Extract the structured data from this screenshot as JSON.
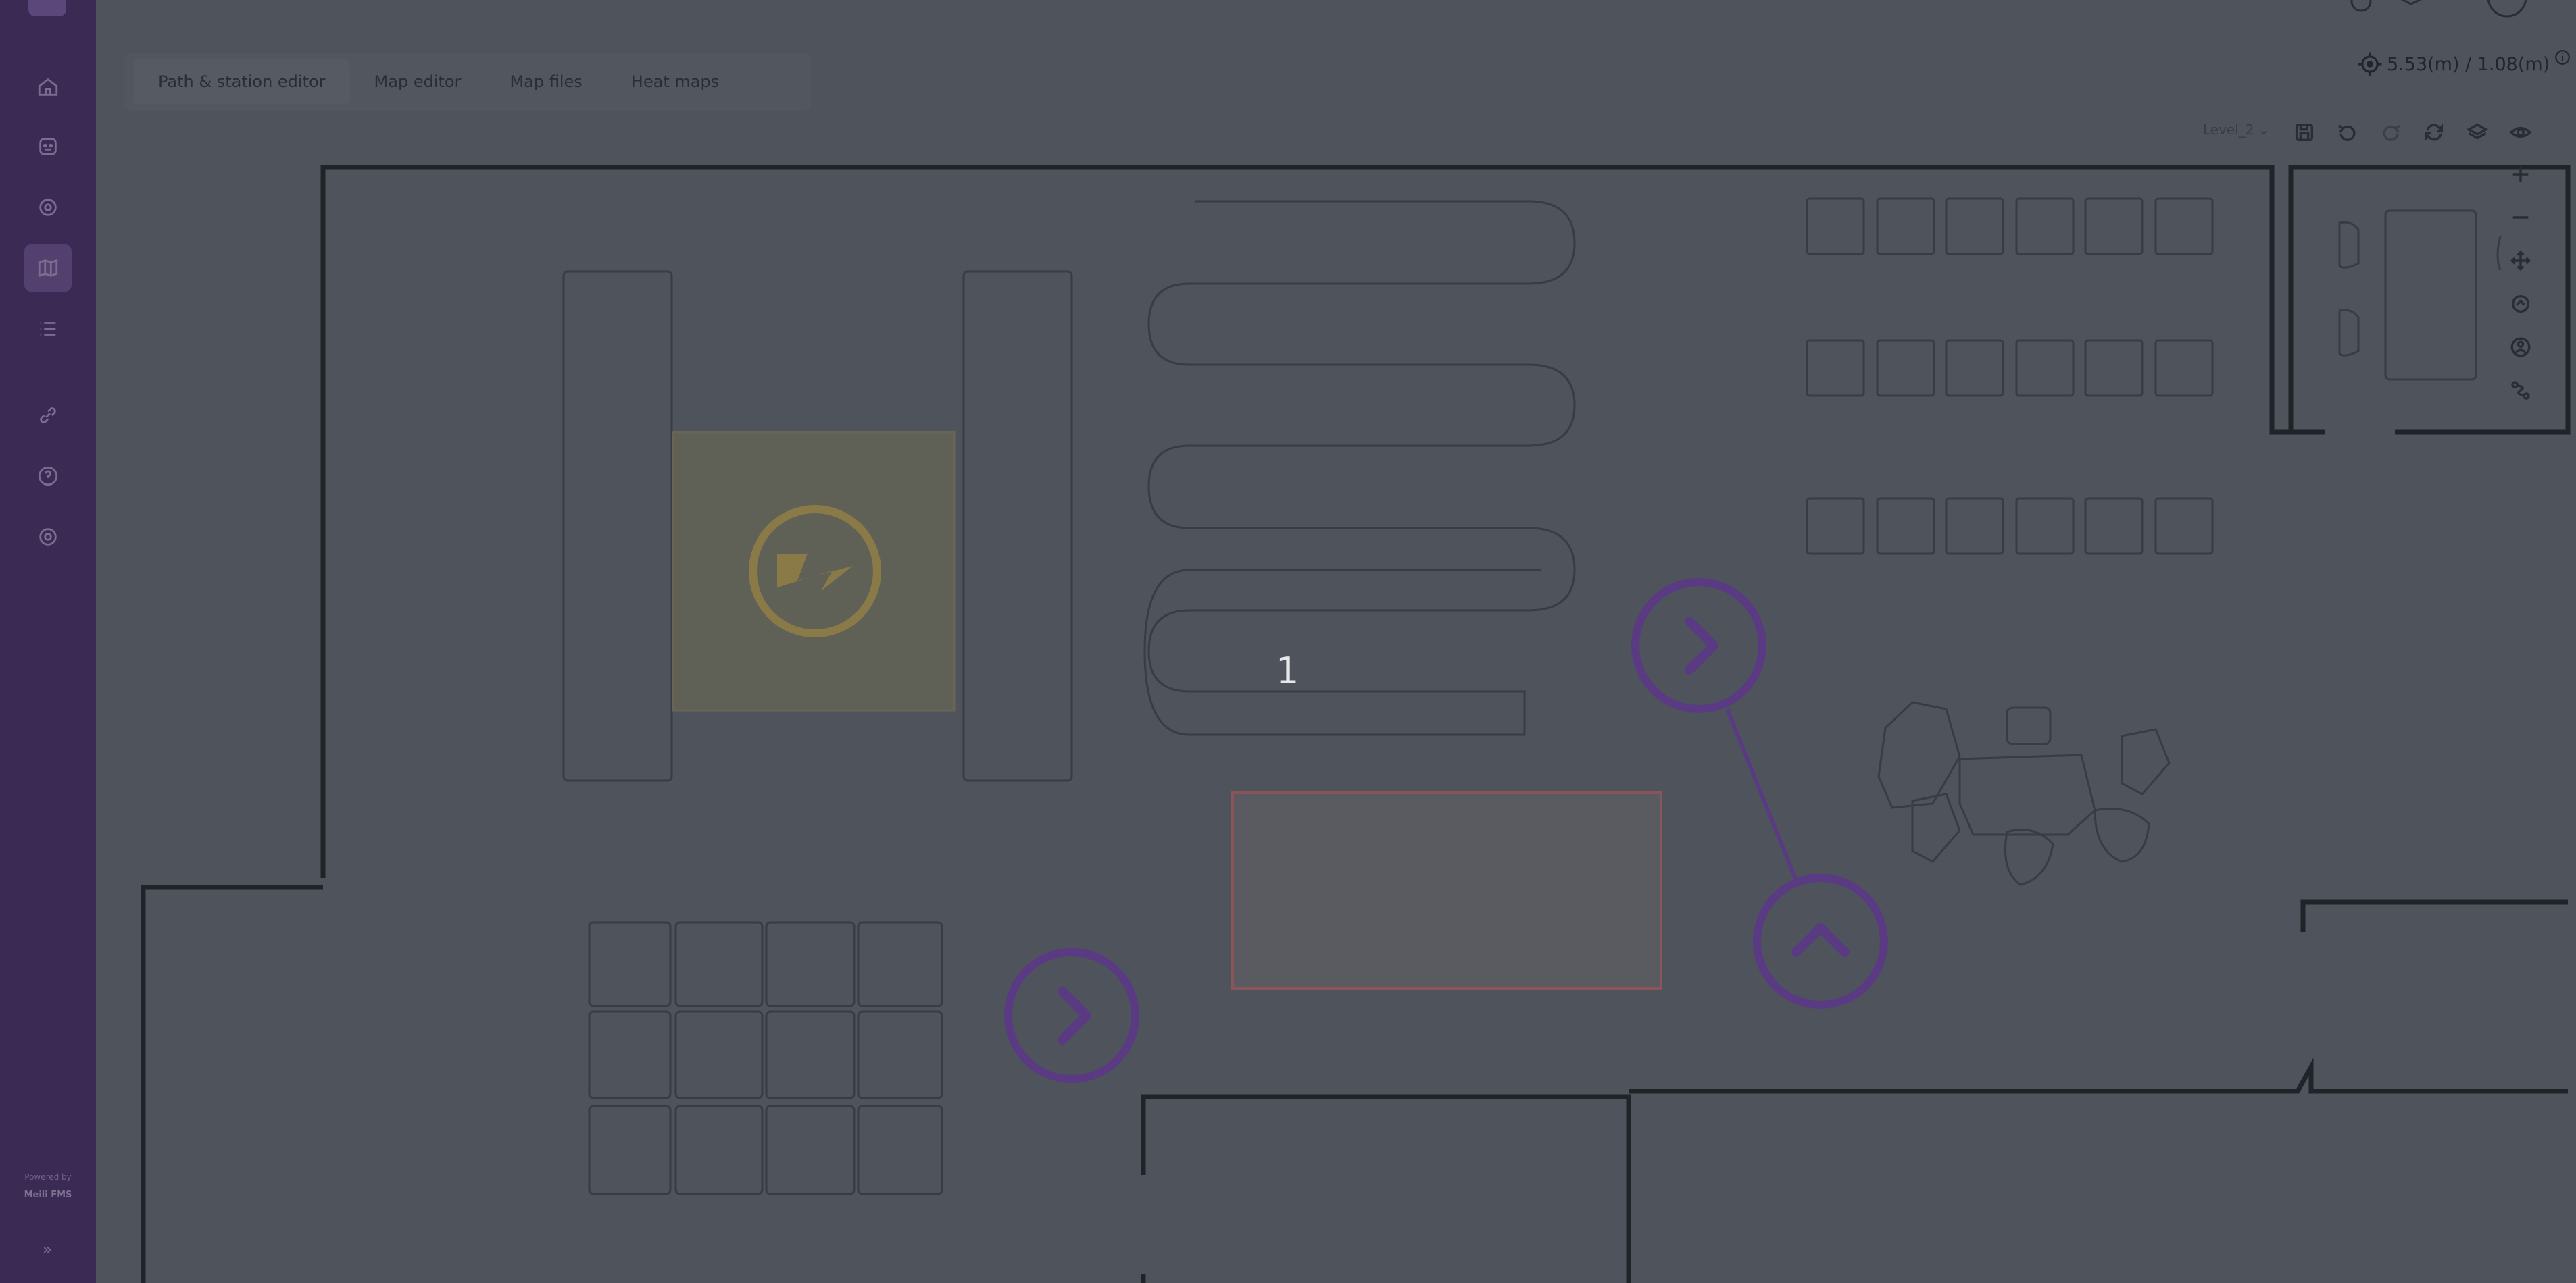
{
  "sidebar": {
    "items": [
      {
        "name": "home-icon"
      },
      {
        "name": "robot-icon"
      },
      {
        "name": "target-icon"
      },
      {
        "name": "map-icon",
        "active": true
      },
      {
        "name": "list-icon"
      },
      {
        "name": "link-icon"
      },
      {
        "name": "help-icon"
      },
      {
        "name": "gear-icon"
      }
    ],
    "powered_by": "Powered by",
    "brand": "Meili FMS",
    "expand": "»"
  },
  "tabs": [
    {
      "label": "Path & station editor",
      "active": true
    },
    {
      "label": "Map editor",
      "active": false
    },
    {
      "label": "Map files",
      "active": false
    },
    {
      "label": "Heat maps",
      "active": false
    }
  ],
  "coordinates": {
    "text": "5.53(m) / 1.08(m)"
  },
  "toolbar": {
    "level": "Level_2",
    "tools": [
      "save-icon",
      "undo-icon",
      "redo-icon",
      "refresh-icon",
      "layers-icon",
      "eye-icon"
    ]
  },
  "map_controls": [
    "zoom-in-icon",
    "zoom-out-icon",
    "pan-icon",
    "recenter-icon",
    "person-icon",
    "route-icon"
  ],
  "map": {
    "label": "1",
    "colors": {
      "walls": "#202328",
      "outlines": "#383c43",
      "charger_zone": "#5f6157",
      "charger_icon": "#8a7a48",
      "restricted_zone": "#8a5458",
      "station": "#5a3b83"
    }
  }
}
